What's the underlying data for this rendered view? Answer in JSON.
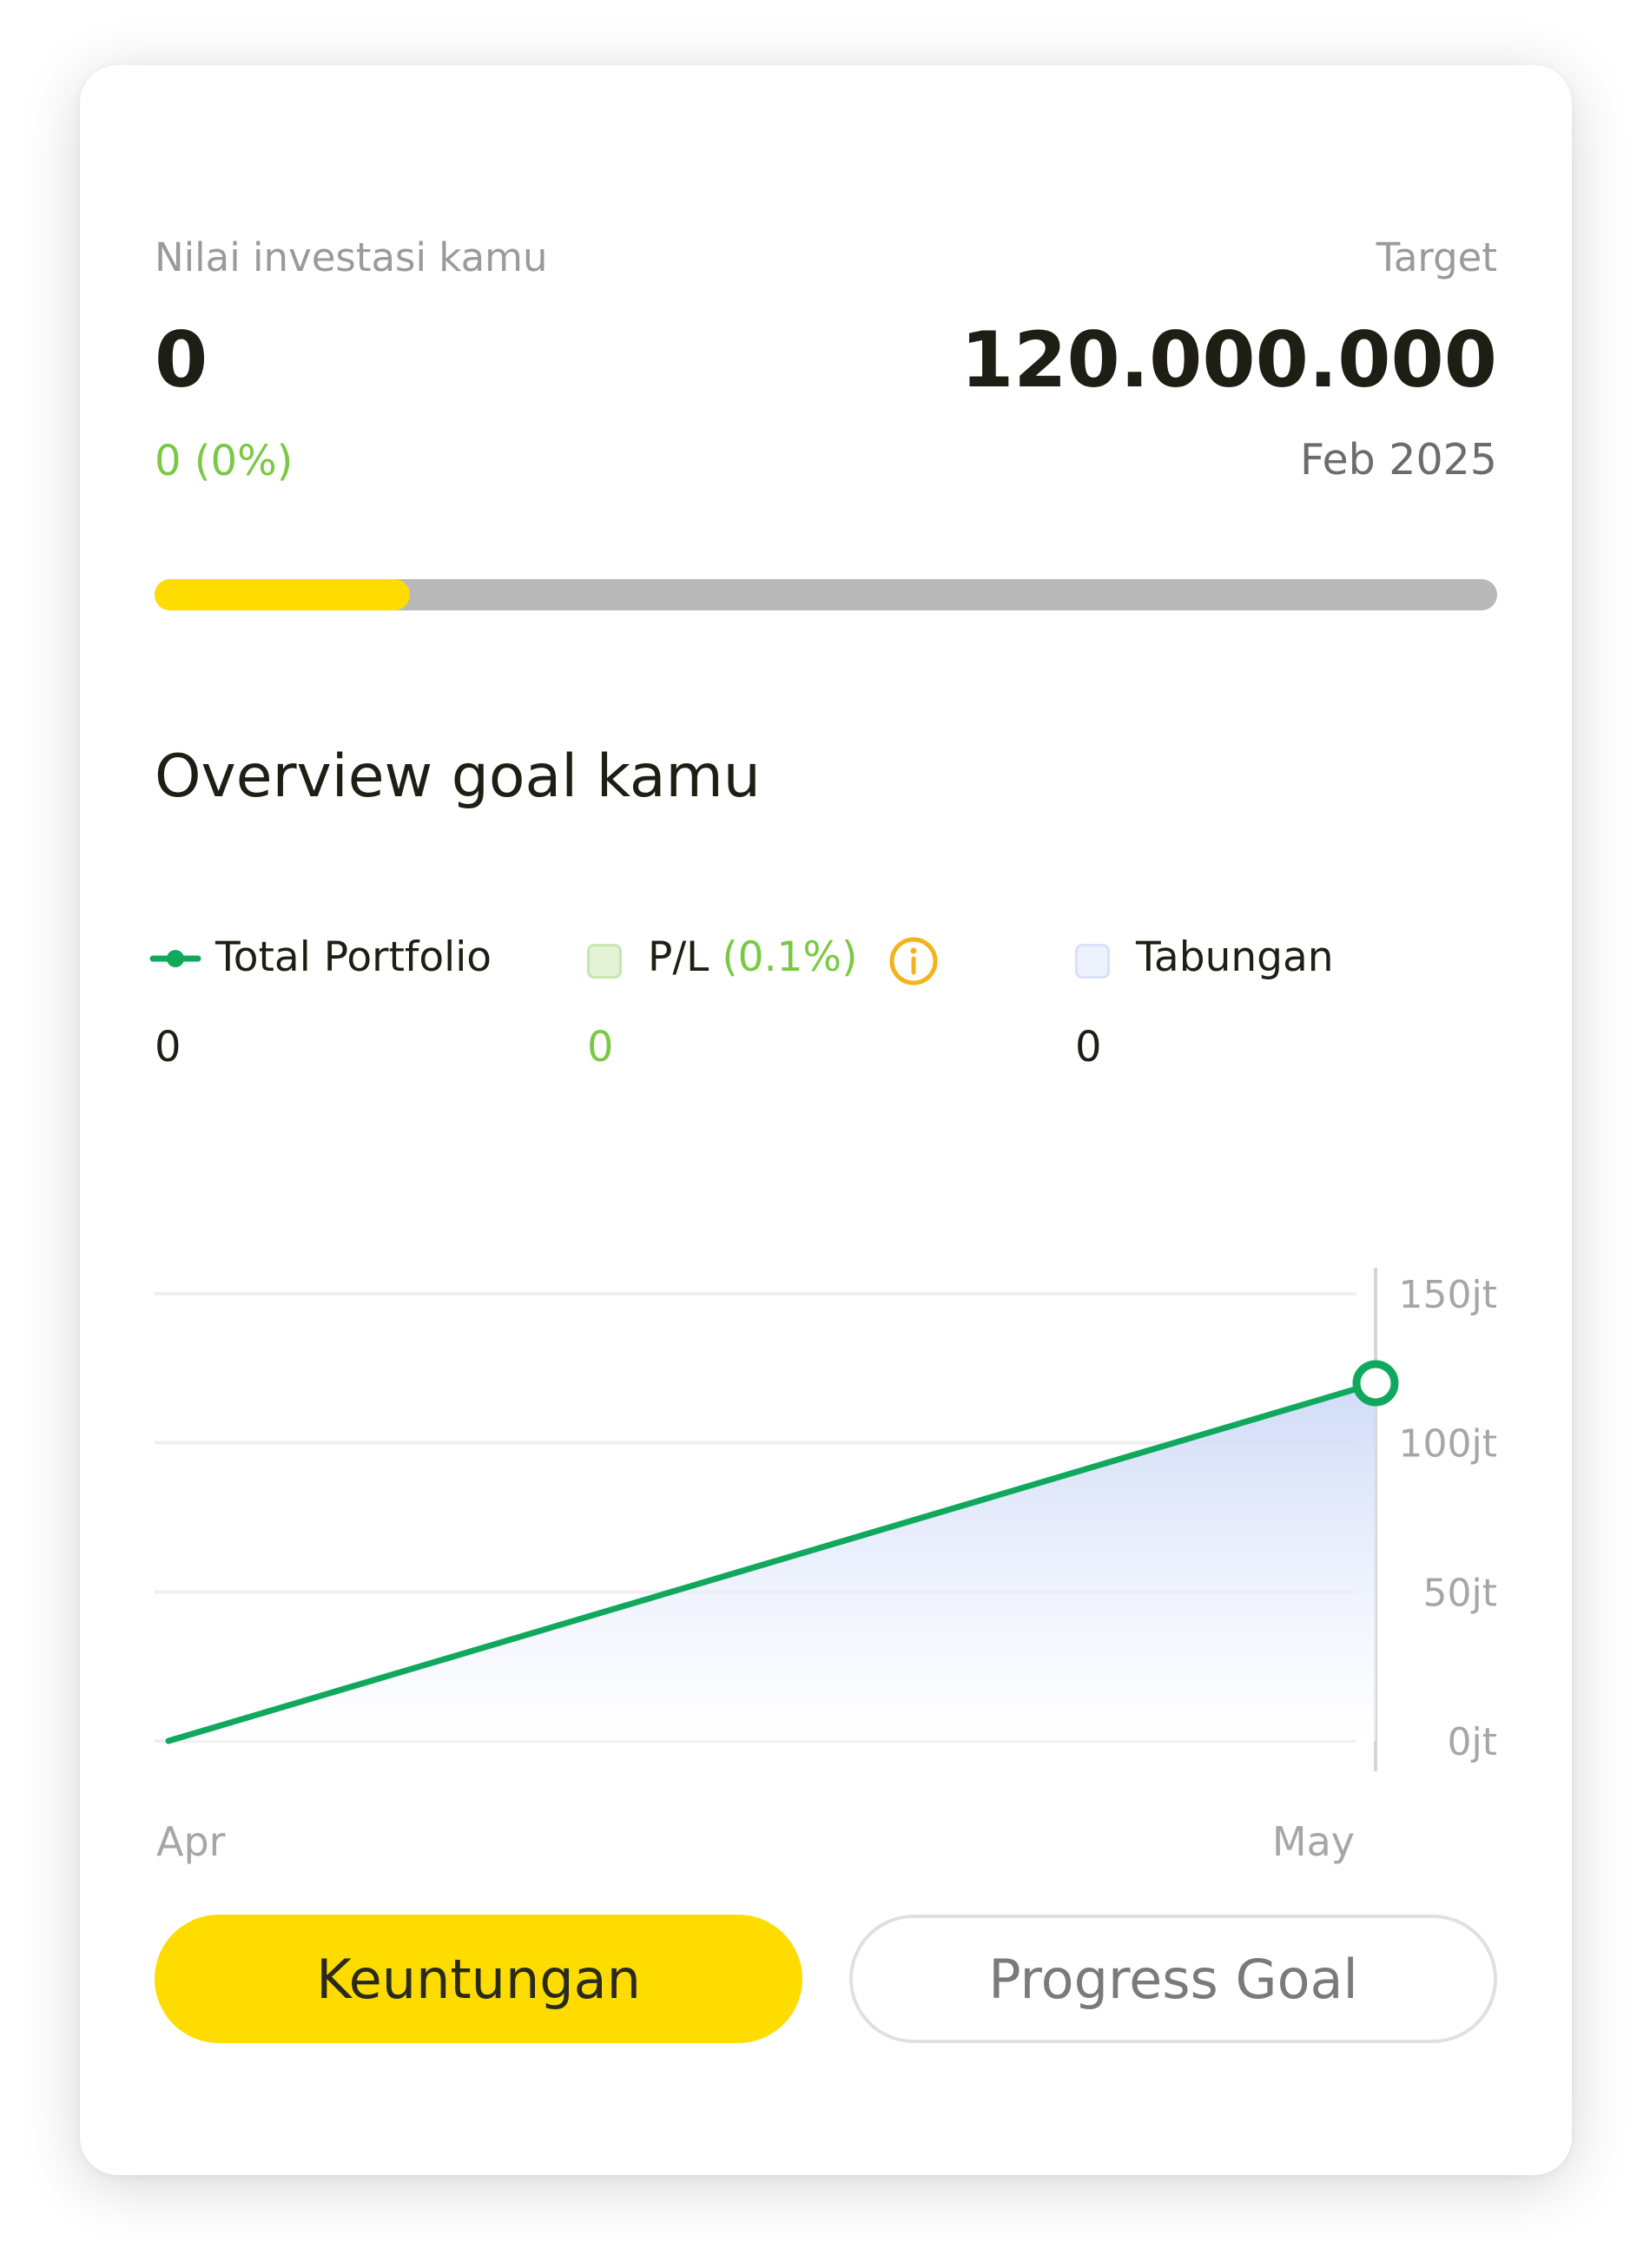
{
  "summary": {
    "investment_label": "Nilai investasi kamu",
    "investment_value": "0",
    "investment_change": "0 (0%)",
    "target_label": "Target",
    "target_value": "120.000.000",
    "target_date": "Feb 2025",
    "progress_fraction": 0.19
  },
  "overview": {
    "title": "Overview goal kamu",
    "legend": {
      "total_portfolio": {
        "label": "Total Portfolio",
        "value": "0"
      },
      "pl": {
        "label": "P/L",
        "pct": "(0.1%)",
        "value": "0"
      },
      "tabungan": {
        "label": "Tabungan",
        "value": "0"
      }
    }
  },
  "colors": {
    "accent_yellow": "#ffdc00",
    "line_green": "#0fa85c",
    "positive_green": "#7ac943",
    "info_orange": "#f5b21b",
    "area_blue": "#cdd9f7",
    "pl_swatch": "#e3f3d6",
    "tabungan_swatch": "#eef2fd"
  },
  "icons": {
    "total_portfolio_marker": "line-dot-icon",
    "pl_swatch": "square-swatch-icon",
    "info": "info-circle-icon",
    "tabungan_swatch": "square-swatch-icon"
  },
  "chart_data": {
    "type": "area",
    "categories": [
      "Apr",
      "May"
    ],
    "series": [
      {
        "name": "Total Portfolio",
        "values": [
          0,
          120
        ]
      }
    ],
    "y_ticks": [
      "150jt",
      "100jt",
      "50jt",
      "0jt"
    ],
    "y_tick_values": [
      150,
      100,
      50,
      0
    ],
    "ylim": [
      0,
      150
    ],
    "y_unit": "jt",
    "grid": true
  },
  "buttons": {
    "keuntungan": "Keuntungan",
    "progress_goal": "Progress Goal"
  }
}
